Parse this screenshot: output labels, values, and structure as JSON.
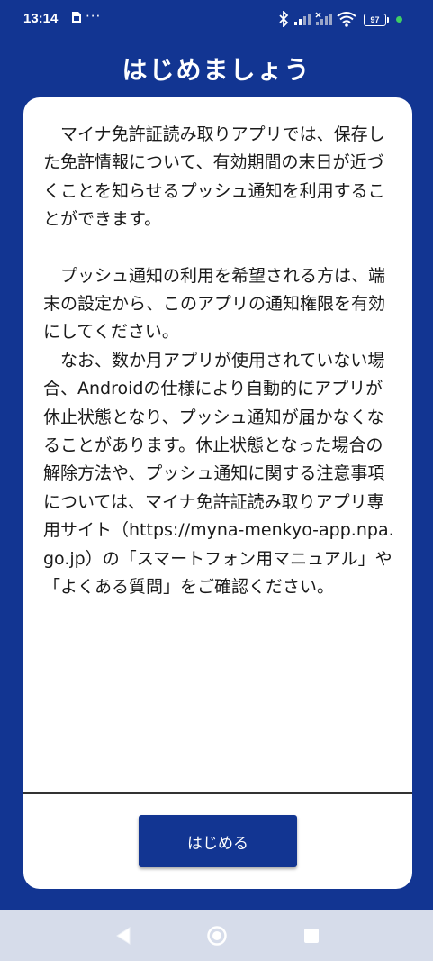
{
  "status_bar": {
    "time": "13:14",
    "notification_icon": "sim-notification-icon",
    "more": "···",
    "battery_level": "97",
    "icons": [
      "bluetooth-icon",
      "signal-icon",
      "signal-x-icon",
      "wifi-icon",
      "battery-icon",
      "green-dot-indicator"
    ]
  },
  "header": {
    "title": "はじめましょう"
  },
  "content": {
    "paragraph1": "マイナ免許証読み取りアプリでは、保存した免許情報について、有効期間の末日が近づくことを知らせるプッシュ通知を利用することができます。",
    "paragraph2": "プッシュ通知の利用を希望される方は、端末の設定から、このアプリの通知権限を有効にしてください。",
    "paragraph3": "なお、数か月アプリが使用されていない場合、Androidの仕様により自動的にアプリが休止状態となり、プッシュ通知が届かなくなることがあります。休止状態となった場合の解除方法や、プッシュ通知に関する注意事項については、マイナ免許証読み取りアプリ専用サイト（https://myna-menkyo-app.npa.go.jp）の「スマートフォン用マニュアル」や「よくある質問」をご確認ください。"
  },
  "actions": {
    "start_label": "はじめる"
  },
  "nav_bar": {
    "icons": [
      "back-icon",
      "home-icon",
      "recents-icon"
    ]
  },
  "colors": {
    "background": "#123592",
    "card": "#ffffff",
    "button": "#123592",
    "nav_bar": "#d6dcea",
    "accent_dot": "#3fce63"
  }
}
